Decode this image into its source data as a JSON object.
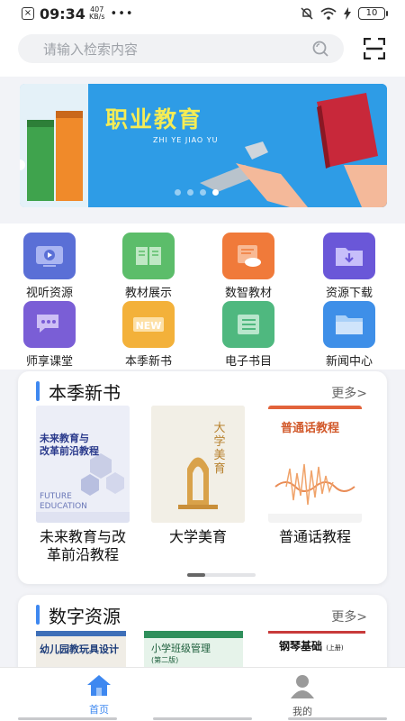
{
  "status": {
    "time": "09:34",
    "speed_value": "407",
    "speed_unit": "KB/s",
    "battery": "10",
    "colors": {
      "text": "#333333"
    }
  },
  "search": {
    "placeholder": "请输入检索内容",
    "search_icon": "search-icon",
    "scan_icon": "scan-icon"
  },
  "banner": {
    "title": "职业教育",
    "subtitle": "ZHI YE JIAO YU",
    "active_dot": 3,
    "dot_count": 4
  },
  "grid": [
    {
      "label": "视听资源",
      "icon": "video-icon",
      "color": "#5a6fd6"
    },
    {
      "label": "教材展示",
      "icon": "book-open-icon",
      "color": "#5cbd6a"
    },
    {
      "label": "数智教材",
      "icon": "cloud-book-icon",
      "color": "#f07a3a"
    },
    {
      "label": "资源下载",
      "icon": "download-folder-icon",
      "color": "#6a57d8"
    },
    {
      "label": "师享课堂",
      "icon": "chat-icon",
      "color": "#7a5ed6"
    },
    {
      "label": "本季新书",
      "icon": "new-badge-icon",
      "color": "#f3b13a"
    },
    {
      "label": "电子书目",
      "icon": "list-icon",
      "color": "#4fb87f"
    },
    {
      "label": "新闻中心",
      "icon": "folder-icon",
      "color": "#3e8fe8"
    }
  ],
  "new_books": {
    "title": "本季新书",
    "more": "更多>",
    "books": [
      {
        "title_line1": "未来教育与改",
        "title_line2": "革前沿教程",
        "cover_title_line1": "未来教育与",
        "cover_title_line2": "改革前沿教程",
        "cover_en_line1": "FUTURE",
        "cover_en_line2": "EDUCATION"
      },
      {
        "title_line1": "大学美育",
        "title_line2": "",
        "cover_title": "大学美育"
      },
      {
        "title_line1": "普通话教程",
        "title_line2": "",
        "cover_title": "普通话教程"
      }
    ]
  },
  "digital": {
    "title": "数字资源",
    "more": "更多>",
    "covers": [
      {
        "text": "幼儿园教玩具设计"
      },
      {
        "text_line1": "小学班级管理",
        "text_line2": "(第二版)"
      },
      {
        "text": "钢琴基础",
        "edition": "(上册)"
      }
    ]
  },
  "tabbar": {
    "home_label": "首页",
    "me_label": "我的",
    "active": "home",
    "colors": {
      "active": "#3e88f0",
      "inactive": "#9a9a9a"
    }
  }
}
